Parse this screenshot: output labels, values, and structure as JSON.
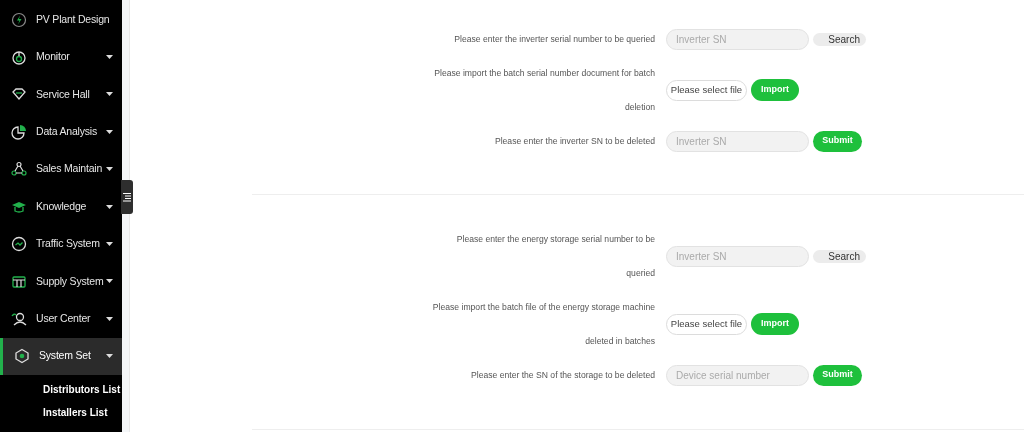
{
  "sidebar": {
    "items": [
      {
        "label": "PV Plant Design",
        "has_caret": false,
        "selected": false
      },
      {
        "label": "Monitor",
        "has_caret": true,
        "selected": false
      },
      {
        "label": "Service Hall",
        "has_caret": true,
        "selected": false
      },
      {
        "label": "Data Analysis",
        "has_caret": true,
        "selected": false
      },
      {
        "label": "Sales Maintain",
        "has_caret": true,
        "selected": false
      },
      {
        "label": "Knowledge",
        "has_caret": true,
        "selected": false
      },
      {
        "label": "Traffic System",
        "has_caret": true,
        "selected": false
      },
      {
        "label": "Supply System",
        "has_caret": true,
        "selected": false
      },
      {
        "label": "User Center",
        "has_caret": true,
        "selected": false
      },
      {
        "label": "System Set",
        "has_caret": true,
        "selected": true,
        "children": [
          {
            "label": "Distributors List"
          },
          {
            "label": "Installers List"
          }
        ]
      }
    ]
  },
  "sections": [
    {
      "rows": [
        {
          "kind": "search",
          "label": "Please enter the inverter serial number to be queried",
          "placeholder": "Inverter SN",
          "button": "Search"
        },
        {
          "kind": "import",
          "label": "Please import the batch serial number document for batch deletion",
          "file": "Please select file",
          "button": "Import"
        },
        {
          "kind": "submit",
          "label": "Please enter the inverter SN to be deleted",
          "placeholder": "Inverter SN",
          "button": "Submit"
        }
      ]
    },
    {
      "rows": [
        {
          "kind": "search",
          "label": "Please enter the energy storage serial number to be queried",
          "placeholder": "Inverter SN",
          "button": "Search"
        },
        {
          "kind": "import",
          "label": "Please import the batch file of the energy storage machine deleted in batches",
          "file": "Please select file",
          "button": "Import"
        },
        {
          "kind": "submit",
          "label": "Please enter the SN of the storage to be deleted",
          "placeholder": "Device serial number",
          "button": "Submit"
        }
      ]
    }
  ]
}
